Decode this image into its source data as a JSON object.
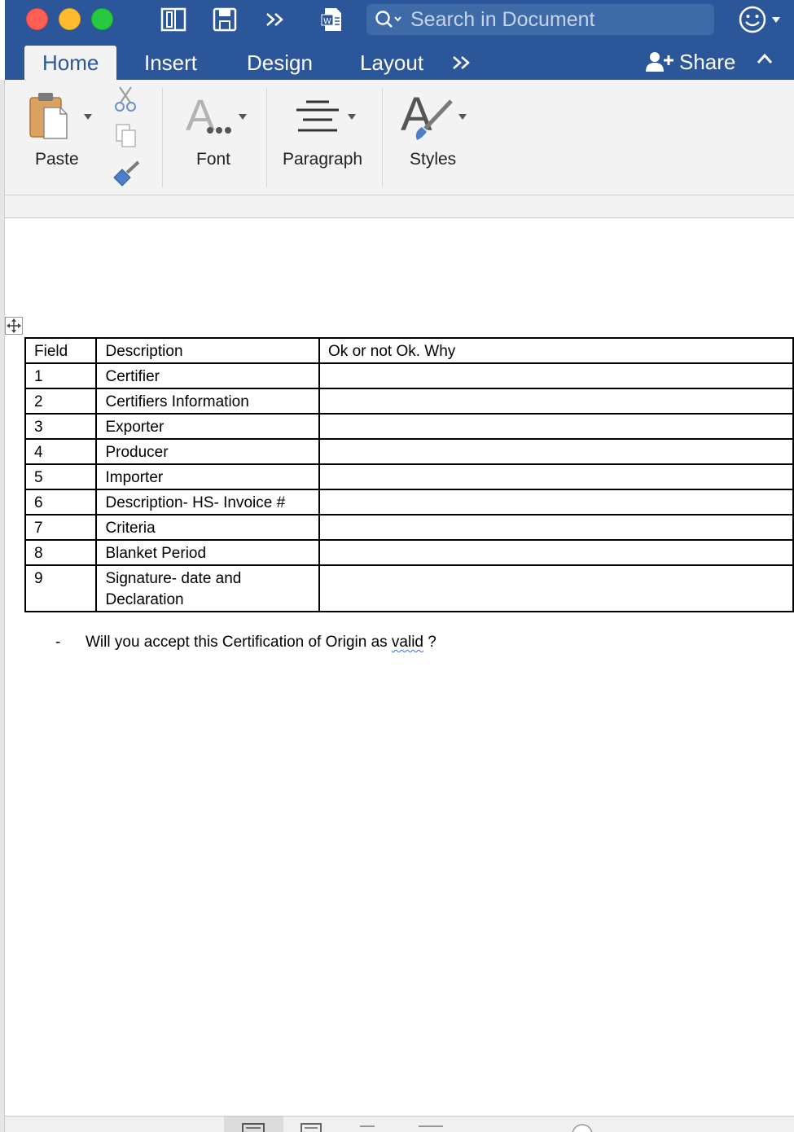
{
  "window": {
    "search_placeholder": "Search in Document"
  },
  "tabs": [
    {
      "label": "Home",
      "active": true
    },
    {
      "label": "Insert",
      "active": false
    },
    {
      "label": "Design",
      "active": false
    },
    {
      "label": "Layout",
      "active": false
    }
  ],
  "share": {
    "label": "Share"
  },
  "ribbon": {
    "paste": "Paste",
    "font": "Font",
    "paragraph": "Paragraph",
    "styles": "Styles"
  },
  "table": {
    "headers": [
      "Field",
      "Description",
      "Ok or not Ok. Why"
    ],
    "rows": [
      {
        "field": "1",
        "description": "Certifier",
        "status": ""
      },
      {
        "field": "2",
        "description": "Certifiers Information",
        "status": ""
      },
      {
        "field": "3",
        "description": "Exporter",
        "status": ""
      },
      {
        "field": "4",
        "description": "Producer",
        "status": ""
      },
      {
        "field": "5",
        "description": "Importer",
        "status": ""
      },
      {
        "field": "6",
        "description": "Description- HS- Invoice #",
        "status": ""
      },
      {
        "field": "7",
        "description": "Criteria",
        "status": ""
      },
      {
        "field": "8",
        "description": "Blanket Period",
        "status": ""
      },
      {
        "field": "9",
        "description": "Signature- date and Declaration",
        "status": ""
      }
    ]
  },
  "question": {
    "dash": "-",
    "text": "Will you accept this Certification of Origin as",
    "flagged_word": "valid",
    "suffix": " ?"
  },
  "colors": {
    "ribbon_blue": "#2b579a",
    "ribbon_bg": "#f3f3f3"
  }
}
